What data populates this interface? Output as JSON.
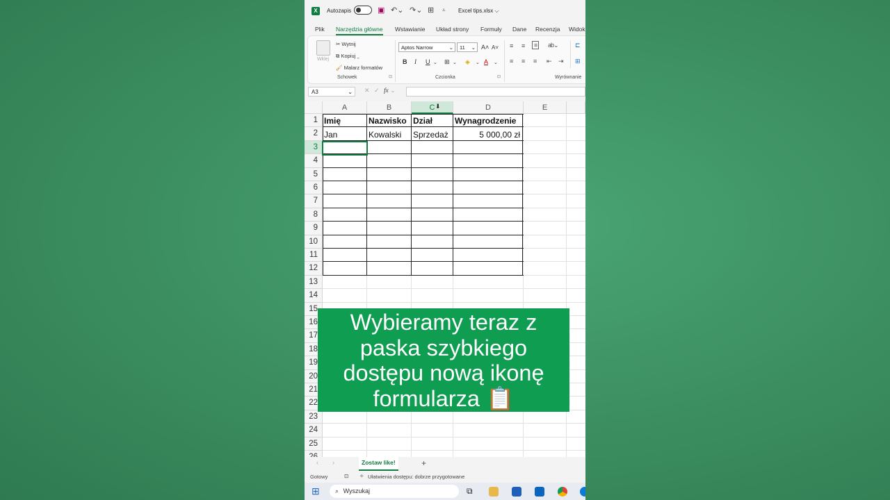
{
  "titlebar": {
    "autosave_label": "Autozapis",
    "filename": "Excel tips.xlsx ⌵"
  },
  "tabs": [
    "Plik",
    "Narzędzia główne",
    "Wstawianie",
    "Układ strony",
    "Formuły",
    "Dane",
    "Recenzja",
    "Widok"
  ],
  "active_tab_index": 1,
  "ribbon": {
    "paste_label": "Wklej",
    "cut_label": "Wytnij",
    "copy_label": "Kopiuj",
    "format_painter_label": "Malarz formatów",
    "clipboard_group": "Schowek",
    "font_name": "Aptos Narrow",
    "font_size": "11",
    "font_group": "Czcionka",
    "alignment_group": "Wyrównanie",
    "bold": "B",
    "italic": "I",
    "underline": "U"
  },
  "formula_bar": {
    "name_box": "A3",
    "fx": "fx",
    "value": ""
  },
  "columns": [
    "A",
    "B",
    "C",
    "D",
    "E"
  ],
  "selected_column": "C",
  "rows": [
    "1",
    "2",
    "3",
    "4",
    "5",
    "6",
    "7",
    "8",
    "9",
    "10",
    "11",
    "12",
    "13",
    "14",
    "15",
    "16",
    "17",
    "18",
    "19",
    "20",
    "21",
    "22",
    "23",
    "24",
    "25",
    "26"
  ],
  "selected_row": "3",
  "table": {
    "headers": [
      "Imię",
      "Nazwisko",
      "Dział",
      "Wynagrodzenie"
    ],
    "data": [
      [
        "Jan",
        "Kowalski",
        "Sprzedaż",
        "5 000,00 zł"
      ]
    ]
  },
  "caption": {
    "text": "Wybieramy teraz z paska szybkiego dostępu nową ikonę formularza 📋"
  },
  "sheet": {
    "tab_name": "Zostaw like!",
    "add": "+"
  },
  "status": {
    "ready": "Gotowy",
    "accessibility": "Ułatwienia dostępu: dobrze przygotowane"
  },
  "taskbar": {
    "search_placeholder": "Wyszukaj"
  }
}
